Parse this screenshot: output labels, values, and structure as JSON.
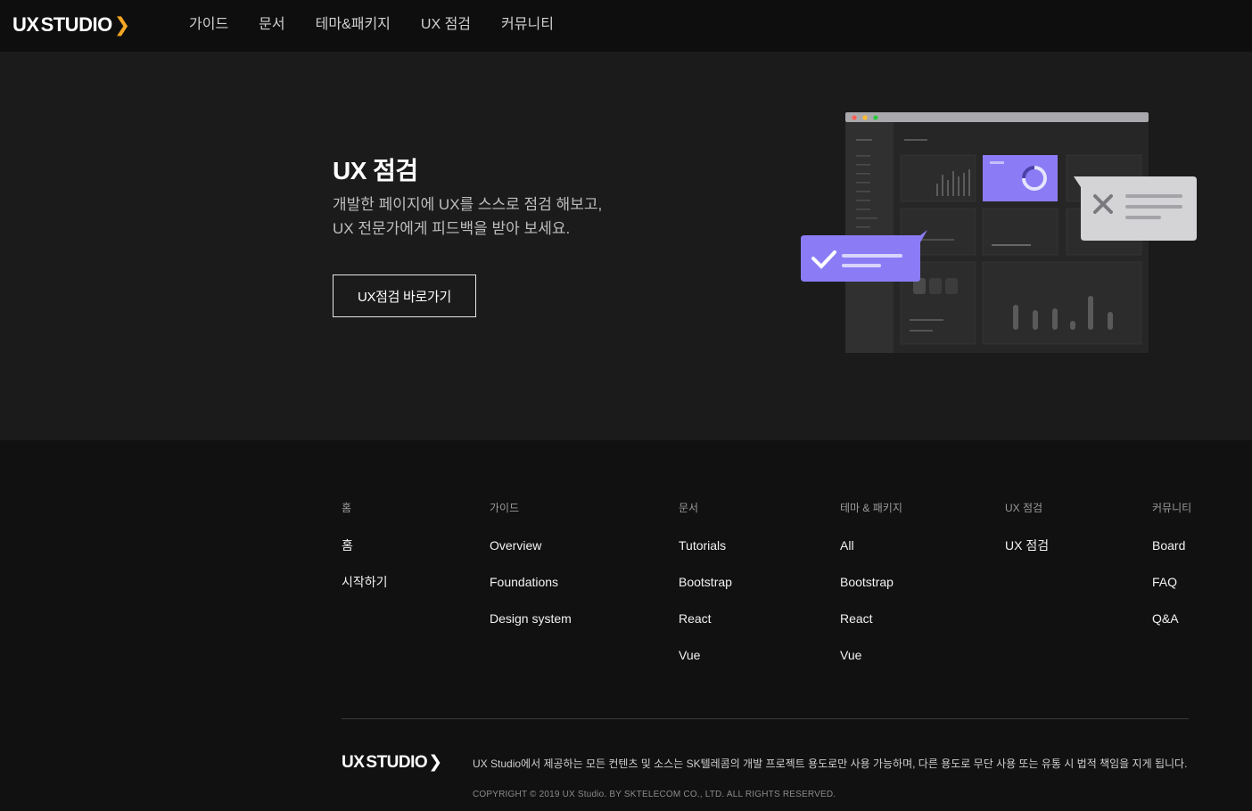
{
  "header": {
    "logo_ux": "UX",
    "logo_studio": "STUDIO",
    "nav": [
      {
        "label": "가이드"
      },
      {
        "label": "문서"
      },
      {
        "label": "테마&패키지"
      },
      {
        "label": "UX 점검"
      },
      {
        "label": "커뮤니티"
      }
    ]
  },
  "hero": {
    "title": "UX 점검",
    "desc_line1": "개발한 페이지에 UX를 스스로 점검 해보고,",
    "desc_line2": "UX 전문가에게 피드백을 받아 보세요.",
    "button_label": "UX점검 바로가기"
  },
  "footer": {
    "columns": [
      {
        "title": "홈",
        "links": [
          "홈",
          "시작하기"
        ]
      },
      {
        "title": "가이드",
        "links": [
          "Overview",
          "Foundations",
          "Design system"
        ]
      },
      {
        "title": "문서",
        "links": [
          "Tutorials",
          "Bootstrap",
          "React",
          "Vue"
        ]
      },
      {
        "title": "테마 & 패키지",
        "links": [
          "All",
          "Bootstrap",
          "React",
          "Vue"
        ]
      },
      {
        "title": "UX 점검",
        "links": [
          "UX 점검"
        ]
      },
      {
        "title": "커뮤니티",
        "links": [
          "Board",
          "FAQ",
          "Q&A"
        ]
      }
    ],
    "logo_ux": "UX",
    "logo_studio": "STUDIO",
    "notice": "UX Studio에서 제공하는 모든 컨텐츠 및 소스는 SK텔레콤의 개발 프로젝트 용도로만 사용 가능하며, 다른 용도로 무단 사용 또는 유통 시 법적 책임을 지게 됩니다.",
    "copyright": "COPYRIGHT © 2019 UX Studio. BY SKTELECOM CO., LTD. ALL RIGHTS RESERVED."
  },
  "colors": {
    "accent_orange": "#f5a623",
    "accent_red": "#ff5a1f",
    "purple": "#8b7cf6",
    "bubble_gray": "#d4d4d6"
  }
}
